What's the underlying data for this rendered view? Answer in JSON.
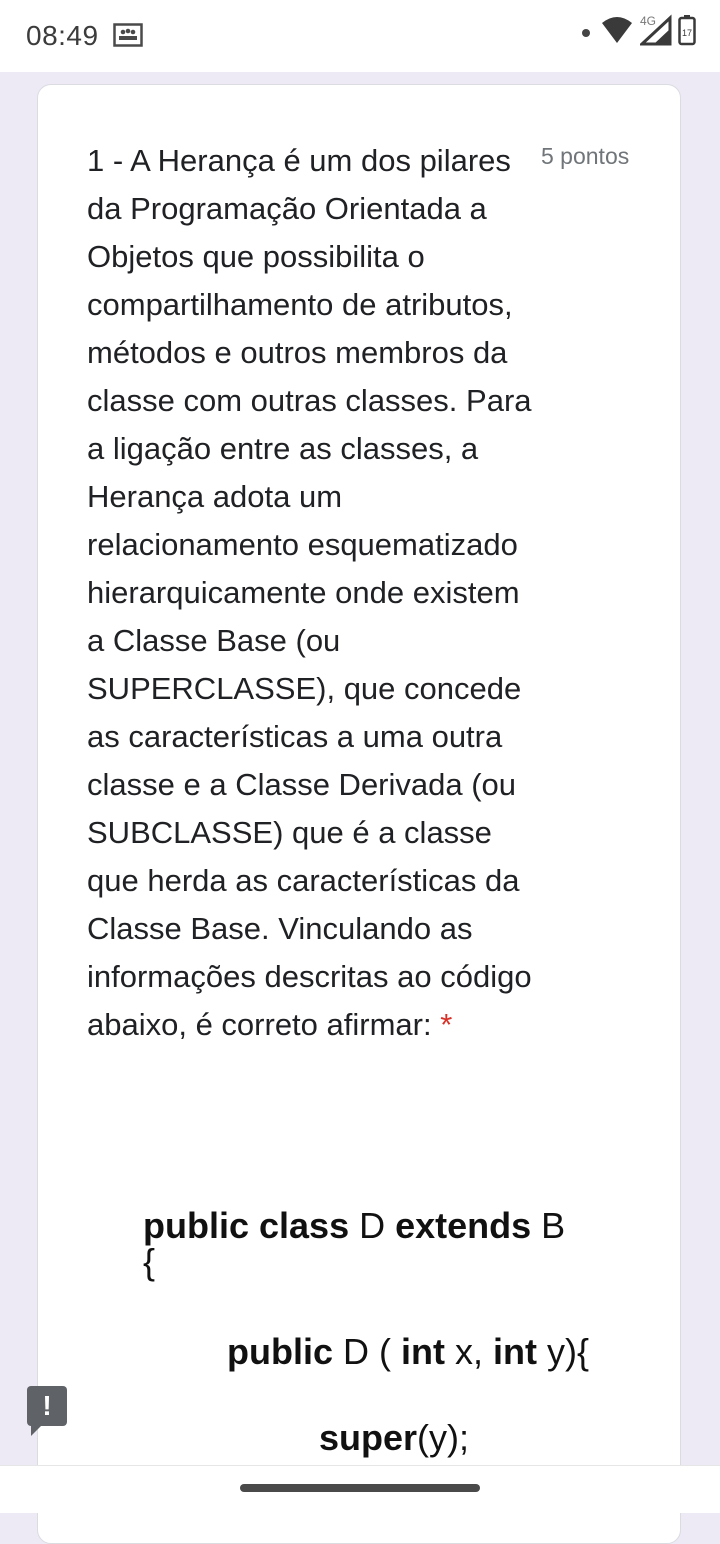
{
  "status_bar": {
    "time": "08:49",
    "network": "4G",
    "battery": "17",
    "icons": [
      "notification-icon",
      "wifi-icon",
      "signal-icon",
      "battery-icon"
    ]
  },
  "question": {
    "text": "1 - A Herança é um dos pilares da Programação Orientada a Objetos que possibilita o compartilhamento de atributos, métodos e outros membros da classe com outras classes. Para a ligação entre as classes, a Herança adota um relacionamento esquematizado hierarquicamente onde existem a Classe Base (ou SUPERCLASSE), que concede as características a uma outra classe e a Classe Derivada (ou SUBCLASSE) que é a classe que herda as características da Classe Base. Vinculando as informações descritas ao código abaixo, é correto afirmar:",
    "required_marker": "*",
    "points": "5 pontos"
  },
  "code": {
    "line1_kw1": "public class",
    "line1_name": " D ",
    "line1_kw2": "extends",
    "line1_base": " B",
    "line2": "{",
    "line3_kw1": "public",
    "line3_a": " D ( ",
    "line3_kw2": "int",
    "line3_b": " x, ",
    "line3_kw3": "int",
    "line3_c": " y){",
    "line4_kw": "super",
    "line4_rest": "(y);"
  },
  "feedback": {
    "label": "!"
  }
}
